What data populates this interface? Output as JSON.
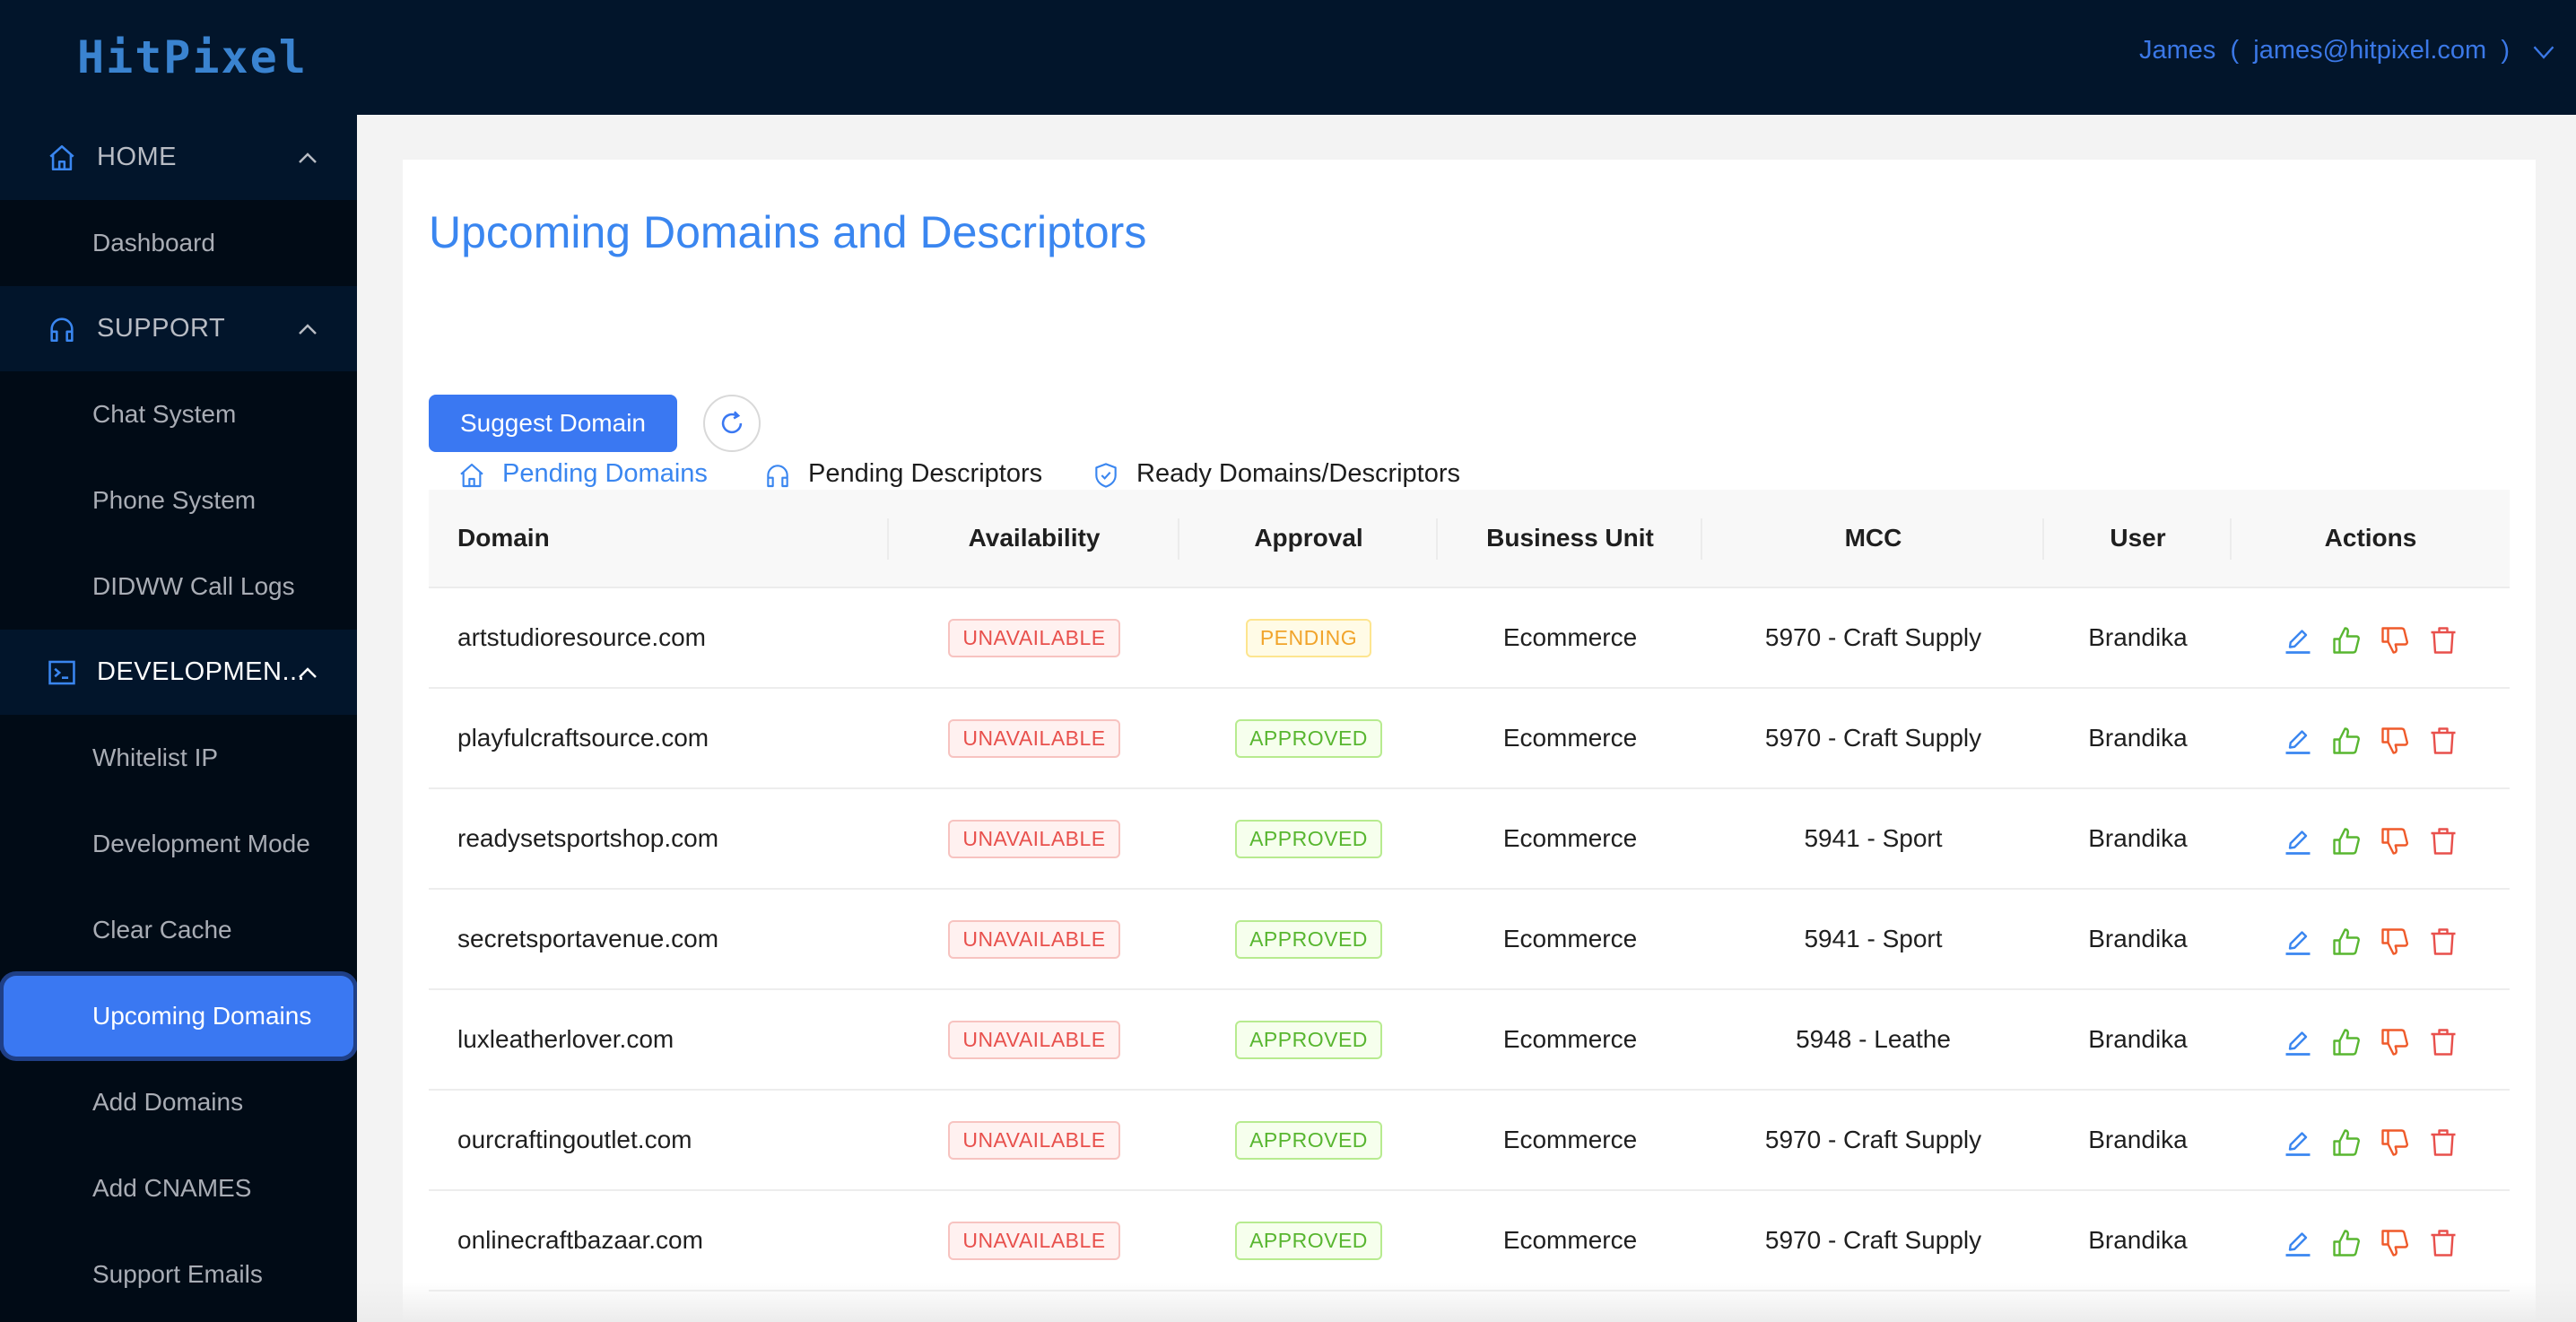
{
  "app": {
    "logo": "HitPixel"
  },
  "header": {
    "user_name": "James",
    "user_email": "james@hitpixel.com",
    "open_paren": "(",
    "close_paren": ")"
  },
  "sidebar": {
    "groups": [
      {
        "label": "HOME",
        "icon": "home-icon",
        "expanded": true,
        "items": [
          {
            "label": "Dashboard"
          }
        ]
      },
      {
        "label": "SUPPORT",
        "icon": "headphones-icon",
        "expanded": true,
        "items": [
          {
            "label": "Chat System"
          },
          {
            "label": "Phone System"
          },
          {
            "label": "DIDWW Call Logs"
          }
        ]
      },
      {
        "label": "DEVELOPMEN...",
        "icon": "terminal-icon",
        "expanded": true,
        "items": [
          {
            "label": "Whitelist IP"
          },
          {
            "label": "Development Mode"
          },
          {
            "label": "Clear Cache"
          },
          {
            "label": "Upcoming Domains",
            "active": true
          },
          {
            "label": "Add Domains"
          },
          {
            "label": "Add CNAMES"
          },
          {
            "label": "Support Emails"
          }
        ]
      }
    ]
  },
  "page": {
    "title": "Upcoming Domains and Descriptors",
    "tabs": [
      {
        "label": "Pending Domains",
        "icon": "home-icon",
        "active": true
      },
      {
        "label": "Pending Descriptors",
        "icon": "headphones-icon"
      },
      {
        "label": "Ready Domains/Descriptors",
        "icon": "shield-check-icon"
      }
    ],
    "suggest_button": "Suggest Domain"
  },
  "table": {
    "columns": [
      "Domain",
      "Availability",
      "Approval",
      "Business Unit",
      "MCC",
      "User",
      "Actions"
    ],
    "rows": [
      {
        "domain": "artstudioresource.com",
        "availability": "UNAVAILABLE",
        "approval": "PENDING",
        "business_unit": "Ecommerce",
        "mcc": "5970 - Craft Supply",
        "user": "Brandika"
      },
      {
        "domain": "playfulcraftsource.com",
        "availability": "UNAVAILABLE",
        "approval": "APPROVED",
        "business_unit": "Ecommerce",
        "mcc": "5970 - Craft Supply",
        "user": "Brandika"
      },
      {
        "domain": "readysetsportshop.com",
        "availability": "UNAVAILABLE",
        "approval": "APPROVED",
        "business_unit": "Ecommerce",
        "mcc": "5941 - Sport",
        "user": "Brandika"
      },
      {
        "domain": "secretsportavenue.com",
        "availability": "UNAVAILABLE",
        "approval": "APPROVED",
        "business_unit": "Ecommerce",
        "mcc": "5941 - Sport",
        "user": "Brandika"
      },
      {
        "domain": "luxleatherlover.com",
        "availability": "UNAVAILABLE",
        "approval": "APPROVED",
        "business_unit": "Ecommerce",
        "mcc": "5948 - Leathe",
        "user": "Brandika"
      },
      {
        "domain": "ourcraftingoutlet.com",
        "availability": "UNAVAILABLE",
        "approval": "APPROVED",
        "business_unit": "Ecommerce",
        "mcc": "5970 - Craft Supply",
        "user": "Brandika"
      },
      {
        "domain": "onlinecraftbazaar.com",
        "availability": "UNAVAILABLE",
        "approval": "APPROVED",
        "business_unit": "Ecommerce",
        "mcc": "5970 - Craft Supply",
        "user": "Brandika"
      }
    ],
    "actions": [
      "edit-icon",
      "thumbs-up-icon",
      "thumbs-down-icon",
      "trash-icon"
    ]
  },
  "colors": {
    "brand": "#3a78f2",
    "title": "#3a86f0",
    "unavailable": "#e8504c",
    "pending": "#f1a42b",
    "approved": "#58b630",
    "thumbs_down": "#ef5a2a",
    "sidebar_bg": "#010b16",
    "topbar_bg": "#02152b"
  }
}
